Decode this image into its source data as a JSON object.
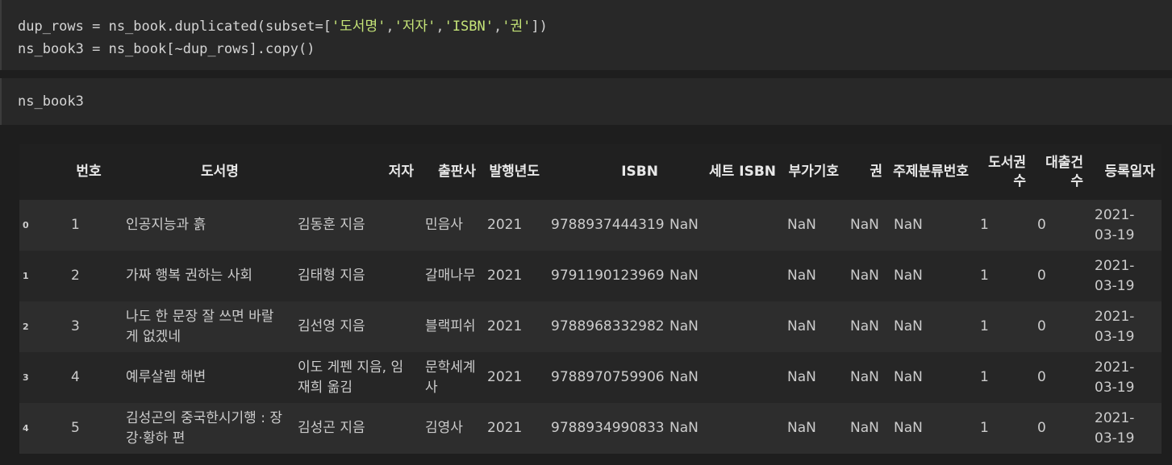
{
  "cells": [
    {
      "lines": [
        [
          "dup_rows = ns_book.duplicated(subset=[",
          "'도서명'",
          ",",
          "'저자'",
          ",",
          "'ISBN'",
          ",",
          "'권'",
          "])"
        ],
        [
          "ns_book3 = ns_book[~dup_rows].copy()"
        ]
      ]
    },
    {
      "lines": [
        [
          "ns_book3"
        ]
      ]
    }
  ],
  "table": {
    "columns": [
      "",
      "번호",
      "도서명",
      "저자",
      "출판사",
      "발행년도",
      "ISBN",
      "세트 ISBN",
      "부가기호",
      "권",
      "주제분류번호",
      "도서권수",
      "대출건수",
      "등록일자"
    ],
    "rows": [
      [
        "0",
        "1",
        "인공지능과 흙",
        "김동훈 지음",
        "민음사",
        "2021",
        "9788937444319",
        "NaN",
        "NaN",
        "NaN",
        "NaN",
        "1",
        "0",
        "2021-03-19"
      ],
      [
        "1",
        "2",
        "가짜 행복 권하는 사회",
        "김태형 지음",
        "갈매나무",
        "2021",
        "9791190123969",
        "NaN",
        "NaN",
        "NaN",
        "NaN",
        "1",
        "0",
        "2021-03-19"
      ],
      [
        "2",
        "3",
        "나도 한 문장 잘 쓰면 바랄 게 없겠네",
        "김선영 지음",
        "블랙피쉬",
        "2021",
        "9788968332982",
        "NaN",
        "NaN",
        "NaN",
        "NaN",
        "1",
        "0",
        "2021-03-19"
      ],
      [
        "3",
        "4",
        "예루살렘 해변",
        "이도 게펜 지음, 임재희 옮김",
        "문학세계사",
        "2021",
        "9788970759906",
        "NaN",
        "NaN",
        "NaN",
        "NaN",
        "1",
        "0",
        "2021-03-19"
      ],
      [
        "4",
        "5",
        "김성곤의 중국한시기행 : 장강·황하 편",
        "김성곤 지음",
        "김영사",
        "2021",
        "9788934990833",
        "NaN",
        "NaN",
        "NaN",
        "NaN",
        "1",
        "0",
        "2021-03-19"
      ]
    ]
  }
}
